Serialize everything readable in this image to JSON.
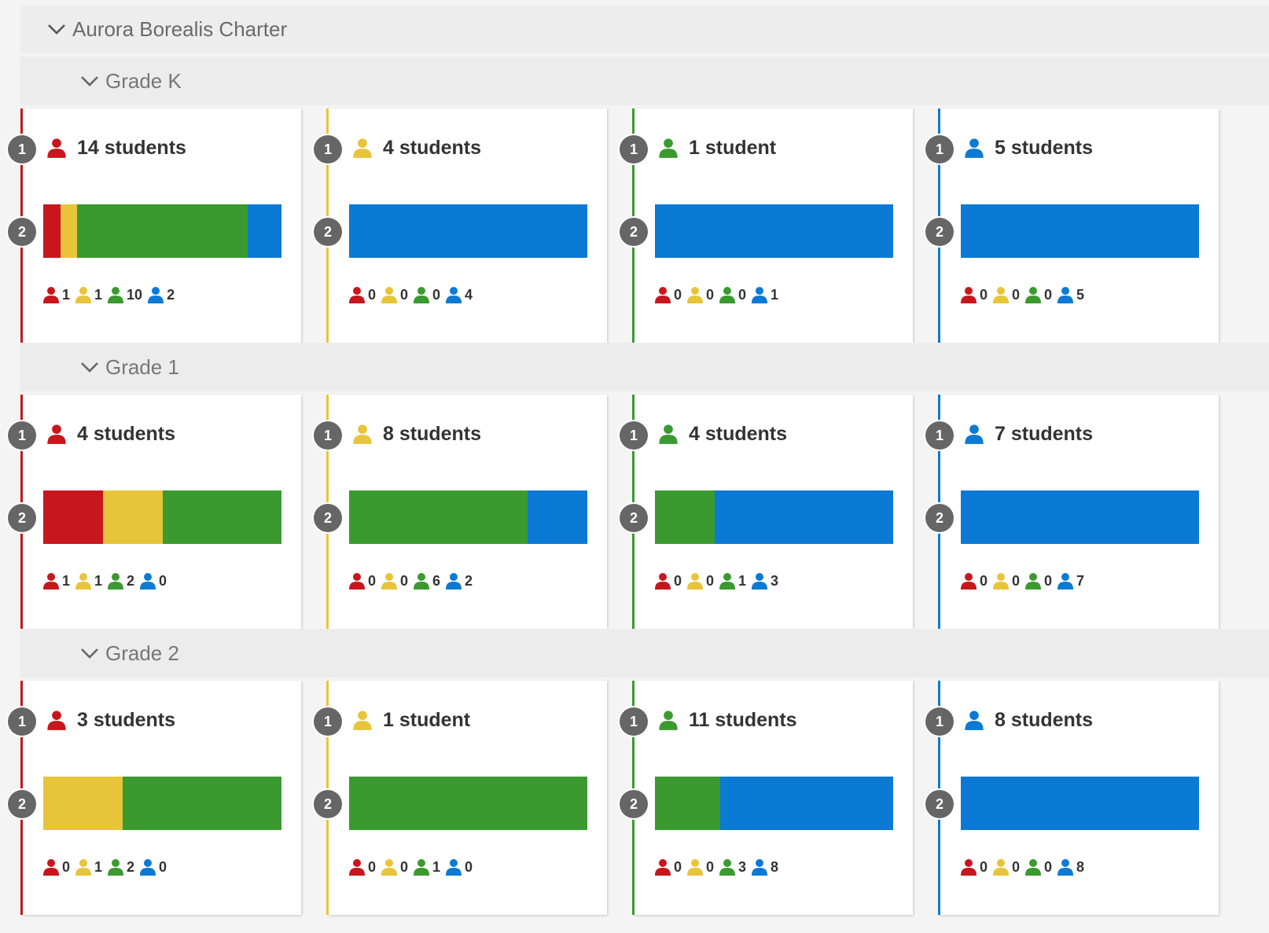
{
  "colors": {
    "red": "#c8161d",
    "yellow": "#e8c43a",
    "green": "#3a9a2f",
    "blue": "#0b7ad4"
  },
  "school": {
    "name": "Aurora Borealis Charter",
    "icon": "chevron-down-icon"
  },
  "grades": [
    {
      "label": "Grade K",
      "cards": [
        {
          "color": "red",
          "title": "14 students",
          "steps": [
            "1",
            "2"
          ],
          "counts": [
            1,
            1,
            10,
            2
          ]
        },
        {
          "color": "yellow",
          "title": "4 students",
          "steps": [
            "1",
            "2"
          ],
          "counts": [
            0,
            0,
            0,
            4
          ]
        },
        {
          "color": "green",
          "title": "1 student",
          "steps": [
            "1",
            "2"
          ],
          "counts": [
            0,
            0,
            0,
            1
          ]
        },
        {
          "color": "blue",
          "title": "5 students",
          "steps": [
            "1",
            "2"
          ],
          "counts": [
            0,
            0,
            0,
            5
          ]
        }
      ]
    },
    {
      "label": "Grade 1",
      "cards": [
        {
          "color": "red",
          "title": "4 students",
          "steps": [
            "1",
            "2"
          ],
          "counts": [
            1,
            1,
            2,
            0
          ]
        },
        {
          "color": "yellow",
          "title": "8 students",
          "steps": [
            "1",
            "2"
          ],
          "counts": [
            0,
            0,
            6,
            2
          ]
        },
        {
          "color": "green",
          "title": "4 students",
          "steps": [
            "1",
            "2"
          ],
          "counts": [
            0,
            0,
            1,
            3
          ]
        },
        {
          "color": "blue",
          "title": "7 students",
          "steps": [
            "1",
            "2"
          ],
          "counts": [
            0,
            0,
            0,
            7
          ]
        }
      ]
    },
    {
      "label": "Grade 2",
      "cards": [
        {
          "color": "red",
          "title": "3 students",
          "steps": [
            "1",
            "2"
          ],
          "counts": [
            0,
            1,
            2,
            0
          ]
        },
        {
          "color": "yellow",
          "title": "1 student",
          "steps": [
            "1",
            "2"
          ],
          "counts": [
            0,
            0,
            1,
            0
          ]
        },
        {
          "color": "green",
          "title": "11 students",
          "steps": [
            "1",
            "2"
          ],
          "counts": [
            0,
            0,
            3,
            8
          ]
        },
        {
          "color": "blue",
          "title": "8 students",
          "steps": [
            "1",
            "2"
          ],
          "counts": [
            0,
            0,
            0,
            8
          ]
        }
      ]
    }
  ]
}
